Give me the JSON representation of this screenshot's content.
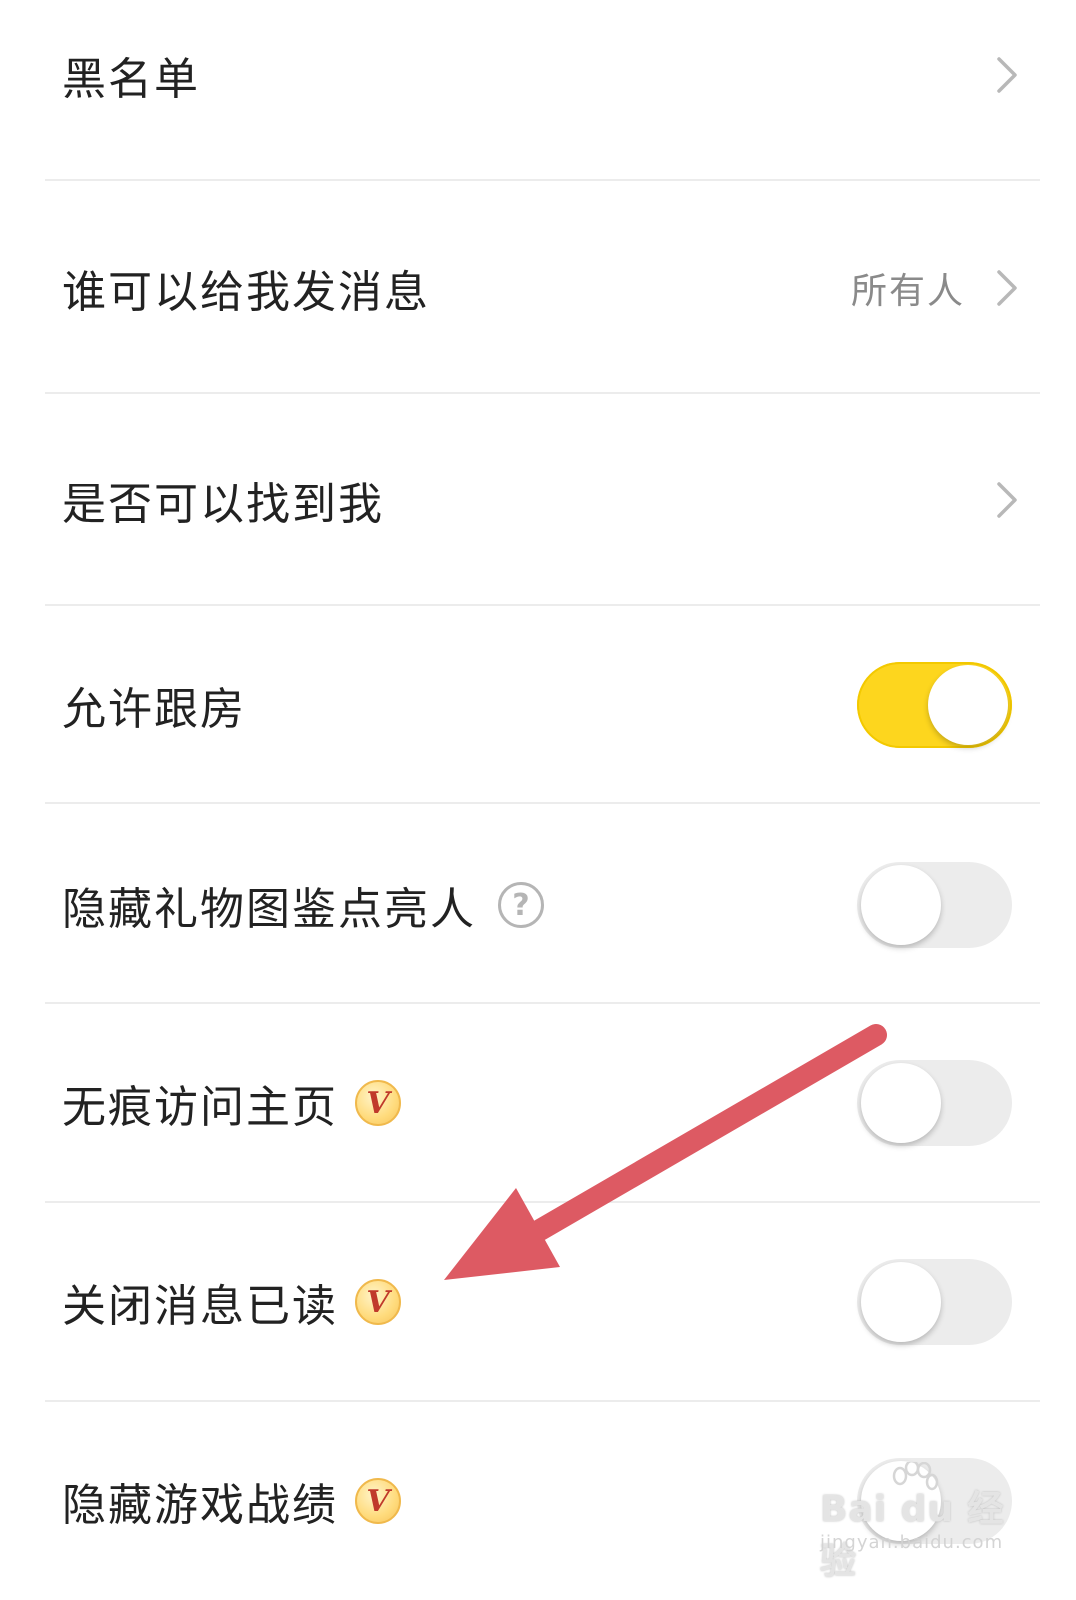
{
  "settings": {
    "blacklist": {
      "label": "黑名单"
    },
    "who_can_message": {
      "label": "谁可以给我发消息",
      "value": "所有人"
    },
    "findable": {
      "label": "是否可以找到我"
    },
    "allow_follow_room": {
      "label": "允许跟房",
      "enabled": true
    },
    "hide_gift_collection": {
      "label": "隐藏礼物图鉴点亮人",
      "help_icon": "question-circle-icon",
      "enabled": false
    },
    "invisible_visit": {
      "label": "无痕访问主页",
      "badge": "V",
      "enabled": false
    },
    "close_read_receipt": {
      "label": "关闭消息已读",
      "badge": "V",
      "enabled": false
    },
    "hide_game_record": {
      "label": "隐藏游戏战绩",
      "badge": "V",
      "enabled": false
    }
  },
  "colors": {
    "toggle_on": "#fdd61e",
    "toggle_off": "#ececec",
    "annotation_arrow": "#dd5a63",
    "badge_text": "#c0392b"
  },
  "watermark": {
    "brand": "Bai du 经验",
    "url": "jingyan.baidu.com"
  }
}
